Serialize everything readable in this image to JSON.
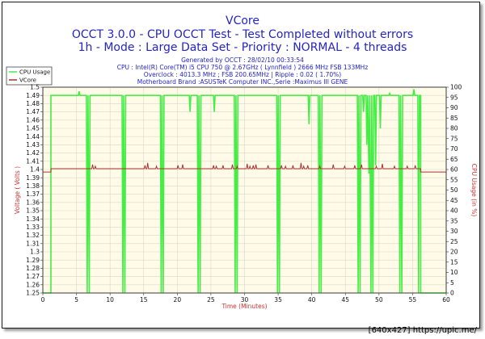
{
  "header": {
    "title": "VCore",
    "subtitle1": "OCCT 3.0.0 - CPU OCCT Test - Test Completed without errors",
    "subtitle2": "1h - Mode : Large Data Set - Priority : NORMAL - 4 threads",
    "info": [
      "Generated by OCCT : 28/02/10 00:33:54",
      "CPU : Intel(R) Core(TM) i5 CPU 750 @ 2.67GHz ( Lynnfield ) 2666 MHz FSB 133MHz",
      "Overclock : 4013.3 MHz ; FSB 200.65MHz | Ripple : 0.02 ( 1.70%)",
      "Motherboard Brand :ASUSTeK Computer INC.,Serie :Maximus III GENE"
    ]
  },
  "credit": "[640x427] https://upic.me/",
  "colors": {
    "cpu_usage": "#44ee44",
    "vcore": "#a83232",
    "plot_bg": "#fffbe8",
    "grid": "#d8d8c8",
    "title": "#2424c8",
    "axis_label": "#c83232"
  },
  "chart_data": {
    "type": "line",
    "xlabel": "Time (Minutes)",
    "ylabel_left": "Voltage ( Volts )",
    "ylabel_right": "CPU Usage (in %)",
    "xlim": [
      0,
      60
    ],
    "ylim_left": [
      1.25,
      1.5
    ],
    "ylim_right": [
      0,
      100
    ],
    "x_ticks": [
      "0",
      "5",
      "10",
      "15",
      "20",
      "25",
      "30",
      "35",
      "40",
      "45",
      "50",
      "55",
      "60"
    ],
    "y_left_ticks": [
      "1.25",
      "1.26",
      "1.27",
      "1.28",
      "1.29",
      "1.3",
      "1.31",
      "1.32",
      "1.33",
      "1.34",
      "1.35",
      "1.36",
      "1.37",
      "1.38",
      "1.39",
      "1.4",
      "1.41",
      "1.42",
      "1.43",
      "1.44",
      "1.45",
      "1.46",
      "1.47",
      "1.48",
      "1.49",
      "1.5"
    ],
    "y_right_ticks": [
      "0",
      "5",
      "10",
      "15",
      "20",
      "25",
      "30",
      "35",
      "40",
      "45",
      "50",
      "55",
      "60",
      "65",
      "70",
      "75",
      "80",
      "85",
      "90",
      "95",
      "100"
    ],
    "grid": true,
    "legend_position": "top-left",
    "series": [
      {
        "name": "CPU Usage",
        "axis": "right",
        "baseline": 96,
        "before_start": 0,
        "after_end": 0,
        "start": 1.2,
        "end": 56.2,
        "dips": [
          [
            5.4,
            98
          ],
          [
            6.6,
            0
          ],
          [
            6.9,
            0
          ],
          [
            11.9,
            0
          ],
          [
            12.2,
            0
          ],
          [
            17.6,
            0
          ],
          [
            17.9,
            0
          ],
          [
            21.9,
            88
          ],
          [
            23.1,
            0
          ],
          [
            23.4,
            0
          ],
          [
            25.5,
            88
          ],
          [
            28.6,
            0
          ],
          [
            28.9,
            0
          ],
          [
            34.9,
            0
          ],
          [
            35.2,
            0
          ],
          [
            39.6,
            82
          ],
          [
            41.1,
            0
          ],
          [
            41.4,
            0
          ],
          [
            46.9,
            0
          ],
          [
            47.2,
            0
          ],
          [
            47.7,
            88
          ],
          [
            48.2,
            72
          ],
          [
            48.5,
            58
          ],
          [
            48.8,
            0
          ],
          [
            49.1,
            0
          ],
          [
            49.5,
            62
          ],
          [
            50.2,
            80
          ],
          [
            51.6,
            97
          ],
          [
            53.1,
            0
          ],
          [
            53.4,
            0
          ],
          [
            55.2,
            99
          ],
          [
            55.9,
            0
          ]
        ]
      },
      {
        "name": "VCore",
        "axis": "left",
        "before_start": 1.397,
        "baseline": 1.401,
        "after_end": 1.397,
        "start": 1.2,
        "end": 56.2,
        "spikes": [
          [
            7.4,
            1.406
          ],
          [
            7.8,
            1.404
          ],
          [
            15.2,
            1.405
          ],
          [
            15.6,
            1.408
          ],
          [
            16.9,
            1.404
          ],
          [
            20.1,
            1.405
          ],
          [
            20.8,
            1.406
          ],
          [
            25.4,
            1.405
          ],
          [
            25.8,
            1.404
          ],
          [
            26.8,
            1.405
          ],
          [
            28.2,
            1.406
          ],
          [
            28.9,
            1.404
          ],
          [
            30.4,
            1.407
          ],
          [
            30.8,
            1.404
          ],
          [
            31.3,
            1.405
          ],
          [
            31.7,
            1.406
          ],
          [
            33.5,
            1.405
          ],
          [
            35.5,
            1.405
          ],
          [
            36.1,
            1.404
          ],
          [
            37.2,
            1.405
          ],
          [
            38.4,
            1.408
          ],
          [
            38.8,
            1.404
          ],
          [
            39.4,
            1.405
          ],
          [
            41.2,
            1.404
          ],
          [
            43.2,
            1.406
          ],
          [
            44.9,
            1.404
          ],
          [
            46.4,
            1.405
          ],
          [
            47.4,
            1.406
          ],
          [
            49.6,
            1.404
          ],
          [
            50.5,
            1.407
          ],
          [
            52.3,
            1.404
          ],
          [
            54.2,
            1.404
          ],
          [
            55.4,
            1.405
          ]
        ]
      }
    ]
  }
}
